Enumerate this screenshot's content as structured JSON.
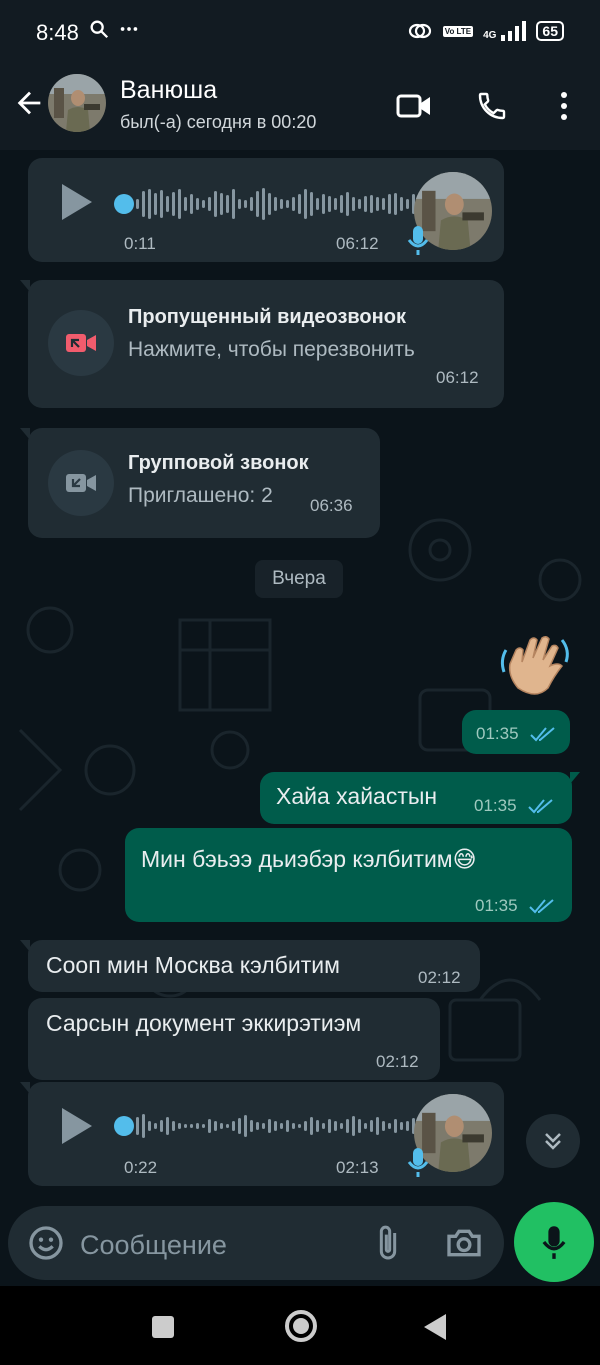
{
  "status_bar": {
    "time": "8:48",
    "net_label": "4G",
    "volte_label": "Vo LTE",
    "battery": "65"
  },
  "header": {
    "contact_name": "Ванюша",
    "last_seen": "был(-а) сегодня в 00:20"
  },
  "messages": {
    "voice_1": {
      "elapsed": "0:11",
      "time": "06:12"
    },
    "missed_call": {
      "title": "Пропущенный видеозвонок",
      "subtitle": "Нажмите, чтобы перезвонить",
      "time": "06:12"
    },
    "group_call": {
      "title": "Групповой звонок",
      "subtitle": "Приглашено: 2",
      "time": "06:36"
    },
    "date_divider": "Вчера",
    "wave_emoji": {
      "emoji": "👋🏼",
      "time": "01:35"
    },
    "out_1": {
      "text": "Хайа хайастын",
      "time": "01:35"
    },
    "out_2": {
      "text": "Мин бэьээ дьиэбэр кэлбитим😅",
      "time": "01:35"
    },
    "in_1": {
      "text": "Сооп мин Москва кэлбитим",
      "time": "02:12"
    },
    "in_2": {
      "text": "Сарсын документ эккирэтиэм",
      "time": "02:12"
    },
    "voice_2": {
      "elapsed": "0:22",
      "time": "02:13"
    }
  },
  "composer": {
    "placeholder": "Сообщение"
  },
  "colors": {
    "accent_green": "#21c063",
    "outgoing_bubble": "#005c4b",
    "incoming_bubble": "#202c33",
    "read_ticks": "#53bdeb",
    "missed_call_red": "#f15c6d"
  },
  "icons": [
    "back-arrow-icon",
    "video-call-icon",
    "phone-icon",
    "more-vert-icon",
    "play-icon",
    "mic-icon",
    "missed-video-call-icon",
    "group-call-icon",
    "read-ticks-icon",
    "scroll-down-icon",
    "emoji-icon",
    "attach-icon",
    "camera-icon",
    "search-icon",
    "link-icon"
  ]
}
